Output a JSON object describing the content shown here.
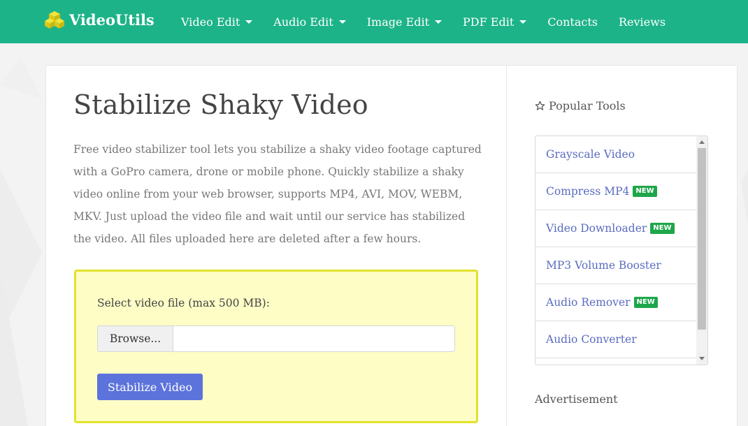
{
  "brand": {
    "name": "VideoUtils",
    "icon": "cubes-icon"
  },
  "nav": {
    "items": [
      {
        "label": "Video Edit",
        "dropdown": true
      },
      {
        "label": "Audio Edit",
        "dropdown": true
      },
      {
        "label": "Image Edit",
        "dropdown": true
      },
      {
        "label": "PDF Edit",
        "dropdown": true
      },
      {
        "label": "Contacts",
        "dropdown": false
      },
      {
        "label": "Reviews",
        "dropdown": false
      }
    ]
  },
  "main": {
    "title": "Stabilize Shaky Video",
    "description": "Free video stabilizer tool lets you stabilize a shaky video footage captured with a GoPro camera, drone or mobile phone. Quickly stabilize a shaky video online from your web browser, supports MP4, AVI, MOV, WEBM, MKV. Just upload the video file and wait until our service has stabilized the video. All files uploaded here are deleted after a few hours.",
    "upload": {
      "label": "Select video file (max 500 MB):",
      "browse_label": "Browse...",
      "file_name": "",
      "submit_label": "Stabilize Video"
    }
  },
  "sidebar": {
    "popular_heading": "Popular Tools",
    "tools": [
      {
        "label": "Grayscale Video",
        "badge": ""
      },
      {
        "label": "Compress MP4",
        "badge": "NEW"
      },
      {
        "label": "Video Downloader",
        "badge": "NEW"
      },
      {
        "label": "MP3 Volume Booster",
        "badge": ""
      },
      {
        "label": "Audio Remover",
        "badge": "NEW"
      },
      {
        "label": "Audio Converter",
        "badge": ""
      }
    ],
    "advertisement_label": "Advertisement"
  },
  "colors": {
    "navbar": "#1db388",
    "upload_panel_bg": "#fefdc6",
    "upload_panel_border": "#e2e22a",
    "submit_button": "#5c73db",
    "badge": "#1ea64a",
    "link": "#5a6cc0"
  }
}
